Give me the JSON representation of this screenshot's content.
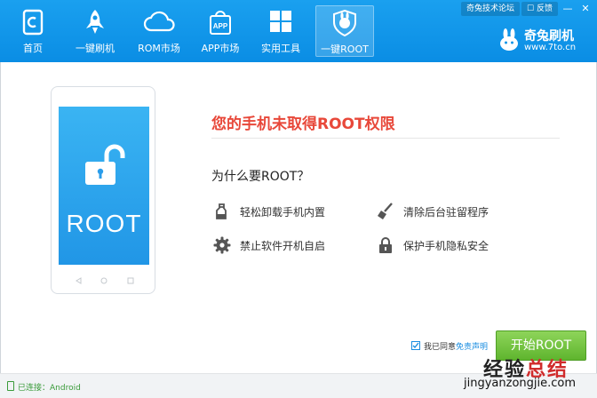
{
  "nav": [
    {
      "label": "首页",
      "icon": "home-icon"
    },
    {
      "label": "一键刷机",
      "icon": "rocket-icon"
    },
    {
      "label": "ROM市场",
      "icon": "cloud-icon"
    },
    {
      "label": "APP市场",
      "icon": "shopping-bag-icon"
    },
    {
      "label": "实用工具",
      "icon": "grid-icon"
    },
    {
      "label": "一键ROOT",
      "icon": "shield-icon",
      "active": true
    }
  ],
  "top_links": {
    "forum": "奇兔技术论坛",
    "feedback": "反馈",
    "minimize": "—",
    "close": "✕"
  },
  "brand": {
    "name": "奇兔刷机",
    "url": "www.7to.cn"
  },
  "phone": {
    "screen_text": "ROOT"
  },
  "content": {
    "headline": "您的手机未取得ROOT权限",
    "why_title": "为什么要ROOT？",
    "features": [
      {
        "label": "轻松卸载手机内置",
        "icon": "uninstall-icon"
      },
      {
        "label": "清除后台驻留程序",
        "icon": "broom-icon"
      },
      {
        "label": "禁止软件开机自启",
        "icon": "gear-icon"
      },
      {
        "label": "保护手机隐私安全",
        "icon": "lock-icon"
      }
    ]
  },
  "footer": {
    "agree_text": "我已同意",
    "agree_link": "免责声明",
    "agree_checked": true,
    "start_button": "开始ROOT",
    "status": "已连接：Android"
  },
  "watermark": {
    "line1_a": "经验",
    "line1_b": "总结",
    "line2": "jingyanzongjie.com"
  },
  "colors": {
    "header": "#0f93e8",
    "headline": "#e8483a",
    "start_button": "#6cc03b",
    "status": "#3a9b3a"
  }
}
